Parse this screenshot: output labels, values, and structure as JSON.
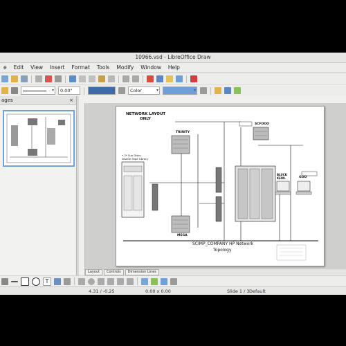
{
  "window": {
    "title": "10966.vsd - LibreOffice Draw"
  },
  "menubar": {
    "items": [
      "e",
      "Edit",
      "View",
      "Insert",
      "Format",
      "Tools",
      "Modify",
      "Window",
      "Help"
    ]
  },
  "toolbar": {
    "line_width": "0.00\"",
    "area_style": "Color"
  },
  "pages_pane": {
    "title": "ages",
    "close": "×"
  },
  "sheet_tabs": [
    "Layout",
    "Controls",
    "Dimension Lines"
  ],
  "drawing": {
    "title_line1": "NETWORK LAYOUT",
    "title_line2": "ONLY",
    "node_trinity": "TRINITY",
    "node_mega": "MEGA",
    "node_scfdoo": "SCFDOO",
    "node_bluck": "BLUCK\nKEWL",
    "node_goo": "GOO",
    "storage_label": "• 2* Sun Disks\nDiskGK Tape Library",
    "footer_line1": "SCIMP_COMPANY HP Network",
    "footer_line2": "Topology"
  },
  "statusbar": {
    "position": "4.31 / -0.25",
    "size": "0.00 x 0.00",
    "slide": "Slide 1 / 3",
    "layout": "Default"
  },
  "colors": {
    "selection_blue": "#6fa3d6",
    "page_white": "#ffffff"
  }
}
